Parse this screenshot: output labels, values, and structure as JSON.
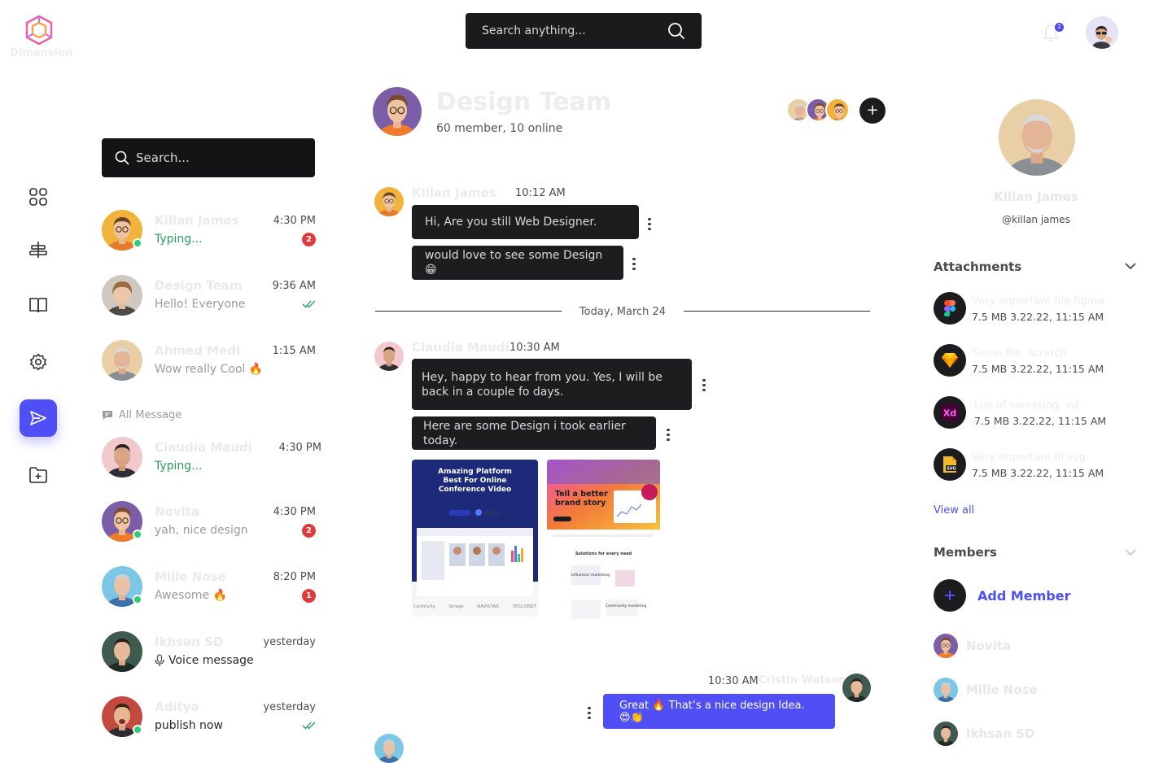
{
  "brand": {
    "name": "Dimension"
  },
  "header": {
    "search_placeholder": "Search anything...",
    "notification_count": "2"
  },
  "sidebar": {
    "items": [
      {
        "icon": "grid-icon"
      },
      {
        "icon": "align-icon"
      },
      {
        "icon": "book-icon"
      },
      {
        "icon": "gear-icon"
      },
      {
        "icon": "send-icon",
        "active": true
      },
      {
        "icon": "folder-add-icon"
      }
    ]
  },
  "chat_list": {
    "search_placeholder": "Search...",
    "section_label": "All Message",
    "items": [
      {
        "name": "Killan James",
        "preview": "Typing...",
        "time": "4:30 PM",
        "badge": "2"
      },
      {
        "name": "Design Team",
        "preview": "Hello! Everyone",
        "time": "9:36 AM"
      },
      {
        "name": "Ahmed Medi",
        "preview": "Wow really Cool 🔥",
        "time": "1:15 AM"
      },
      {
        "name": "Claudia Maudi",
        "preview": "Typing...",
        "time": "4:30 PM"
      },
      {
        "name": "Novita",
        "preview": "yah, nice design",
        "time": "4:30 PM",
        "badge": "2"
      },
      {
        "name": "Milie Nose",
        "preview": "Awesome 🔥",
        "time": "8:20 PM",
        "badge": "1"
      },
      {
        "name": "Ikhsan SD",
        "preview": "Voice message",
        "time": "yesterday"
      },
      {
        "name": "Aditya",
        "preview": "publish now",
        "time": "yesterday"
      }
    ]
  },
  "conversation": {
    "title": "Design Team",
    "subtitle": "60 member, 10 online",
    "divider": "Today, March 24",
    "groups": [
      {
        "sender": "Killan James",
        "time": "10:12 AM",
        "messages": [
          "Hi, Are you still Web Designer.",
          "would love to see some Design 😁"
        ]
      },
      {
        "sender": "Claudia Maudi",
        "time": "10:30 AM",
        "messages": [
          "Hey, happy to hear from you. Yes, I will be back in a couple fo days.",
          "Here are some Design i took earlier today."
        ]
      },
      {
        "sender": "Cristin Watson",
        "time": "10:30 AM",
        "messages": [
          "Great 🔥  That’s a nice design Idea. 😍👏"
        ]
      }
    ],
    "image_one": {
      "headline": "Amazing Platform Best For Online Conference Video",
      "logos": [
        "Centrivity",
        "Strage",
        "NAVISTAR",
        "TESCONST"
      ]
    },
    "image_two": {
      "headline": "Tell a better brand story",
      "section": "Solutions for every need",
      "items": [
        "Influencer marketing",
        "Community marketing"
      ]
    }
  },
  "profile": {
    "name": "Killan James",
    "handle": "@killan james",
    "attachments_title": "Attachments",
    "attachments": [
      {
        "icon": "figma-icon",
        "name": "Very important file.figma",
        "meta": "7.5 MB 3.22.22, 11:15 AM"
      },
      {
        "icon": "sketch-icon",
        "name": "Some file. scratch",
        "meta": "7.5 MB 3.22.22, 11:15 AM"
      },
      {
        "icon": "xd-icon",
        "name": "List of someting. xd",
        "meta": "7.5 MB 3.22.22, 11:15 AM"
      },
      {
        "icon": "svg-file-icon",
        "name": "Very important fil.svg",
        "meta": "7.5 MB 3.22.22, 11:15 AM"
      }
    ],
    "view_all": "View all",
    "members_title": "Members",
    "add_member": "Add Member",
    "members": [
      "Novita",
      "Milie Nose",
      "Ikhsan SD"
    ]
  },
  "colors": {
    "accent": "#4f4ff5",
    "dark": "#1c1c1e",
    "online": "#2ecc71",
    "badge": "#e03a3a"
  }
}
